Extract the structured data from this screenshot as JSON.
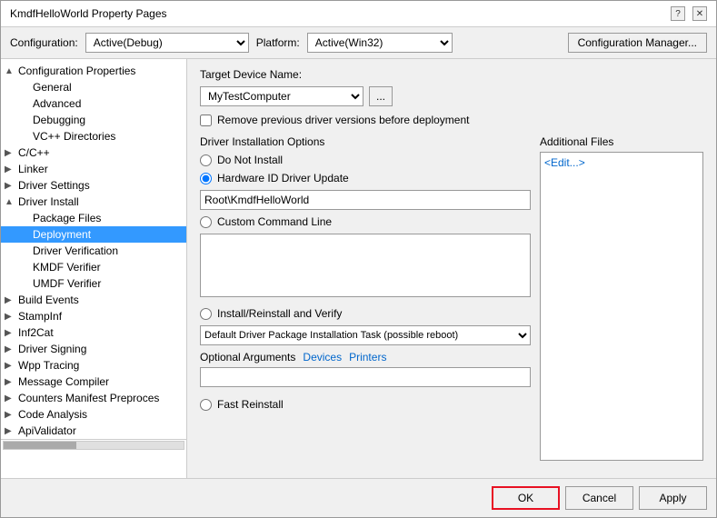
{
  "dialog": {
    "title": "KmdfHelloWorld Property Pages",
    "help_label": "?",
    "close_label": "✕"
  },
  "toolbar": {
    "config_label": "Configuration:",
    "config_value": "Active(Debug)",
    "platform_label": "Platform:",
    "platform_value": "Active(Win32)",
    "config_manager_label": "Configuration Manager..."
  },
  "sidebar": {
    "items": [
      {
        "id": "config-properties",
        "label": "Configuration Properties",
        "indent": 0,
        "expanded": true,
        "has_toggle": true,
        "toggle": "▲"
      },
      {
        "id": "general",
        "label": "General",
        "indent": 1,
        "expanded": false,
        "has_toggle": false
      },
      {
        "id": "advanced",
        "label": "Advanced",
        "indent": 1,
        "expanded": false,
        "has_toggle": false
      },
      {
        "id": "debugging",
        "label": "Debugging",
        "indent": 1,
        "expanded": false,
        "has_toggle": false
      },
      {
        "id": "vc-directories",
        "label": "VC++ Directories",
        "indent": 1,
        "expanded": false,
        "has_toggle": false
      },
      {
        "id": "c-cpp",
        "label": "C/C++",
        "indent": 0,
        "expanded": false,
        "has_toggle": true,
        "toggle": "▶"
      },
      {
        "id": "linker",
        "label": "Linker",
        "indent": 0,
        "expanded": false,
        "has_toggle": true,
        "toggle": "▶"
      },
      {
        "id": "driver-settings",
        "label": "Driver Settings",
        "indent": 0,
        "expanded": false,
        "has_toggle": true,
        "toggle": "▶"
      },
      {
        "id": "driver-install",
        "label": "Driver Install",
        "indent": 0,
        "expanded": true,
        "has_toggle": true,
        "toggle": "▲"
      },
      {
        "id": "package-files",
        "label": "Package Files",
        "indent": 1,
        "expanded": false,
        "has_toggle": false
      },
      {
        "id": "deployment",
        "label": "Deployment",
        "indent": 1,
        "expanded": false,
        "has_toggle": false,
        "selected": true
      },
      {
        "id": "driver-verification",
        "label": "Driver Verification",
        "indent": 1,
        "expanded": false,
        "has_toggle": false
      },
      {
        "id": "kmdf-verifier",
        "label": "KMDF Verifier",
        "indent": 1,
        "expanded": false,
        "has_toggle": false
      },
      {
        "id": "umdf-verifier",
        "label": "UMDF Verifier",
        "indent": 1,
        "expanded": false,
        "has_toggle": false
      },
      {
        "id": "build-events",
        "label": "Build Events",
        "indent": 0,
        "expanded": false,
        "has_toggle": true,
        "toggle": "▶"
      },
      {
        "id": "stampinf",
        "label": "StampInf",
        "indent": 0,
        "expanded": false,
        "has_toggle": true,
        "toggle": "▶"
      },
      {
        "id": "inf2cat",
        "label": "Inf2Cat",
        "indent": 0,
        "expanded": false,
        "has_toggle": true,
        "toggle": "▶"
      },
      {
        "id": "driver-signing",
        "label": "Driver Signing",
        "indent": 0,
        "expanded": false,
        "has_toggle": true,
        "toggle": "▶"
      },
      {
        "id": "wpp-tracing",
        "label": "Wpp Tracing",
        "indent": 0,
        "expanded": false,
        "has_toggle": true,
        "toggle": "▶"
      },
      {
        "id": "message-compiler",
        "label": "Message Compiler",
        "indent": 0,
        "expanded": false,
        "has_toggle": true,
        "toggle": "▶"
      },
      {
        "id": "counters-manifest",
        "label": "Counters Manifest Preproces",
        "indent": 0,
        "expanded": false,
        "has_toggle": true,
        "toggle": "▶"
      },
      {
        "id": "code-analysis",
        "label": "Code Analysis",
        "indent": 0,
        "expanded": false,
        "has_toggle": true,
        "toggle": "▶"
      },
      {
        "id": "api-validator",
        "label": "ApiValidator",
        "indent": 0,
        "expanded": false,
        "has_toggle": true,
        "toggle": "▶"
      }
    ]
  },
  "content": {
    "target_device_label": "Target Device Name:",
    "target_device_value": "MyTestComputer",
    "target_device_placeholder": "MyTestComputer",
    "remove_previous_label": "Remove previous driver versions before deployment",
    "driver_install_options_label": "Driver Installation Options",
    "radio_do_not_install": "Do Not Install",
    "radio_hardware_id": "Hardware ID Driver Update",
    "hardware_id_value": "Root\\KmdfHelloWorld",
    "radio_custom_command": "Custom Command Line",
    "radio_install_reinstall": "Install/Reinstall and Verify",
    "install_task_value": "Default Driver Package Installation Task (possible reboot)",
    "optional_args_label": "Optional Arguments",
    "optional_link_devices": "Devices",
    "optional_link_printers": "Printers",
    "optional_args_value": "",
    "radio_fast_reinstall": "Fast Reinstall",
    "additional_files_label": "Additional Files",
    "additional_files_value": "<Edit...>"
  },
  "footer": {
    "ok_label": "OK",
    "cancel_label": "Cancel",
    "apply_label": "Apply"
  }
}
